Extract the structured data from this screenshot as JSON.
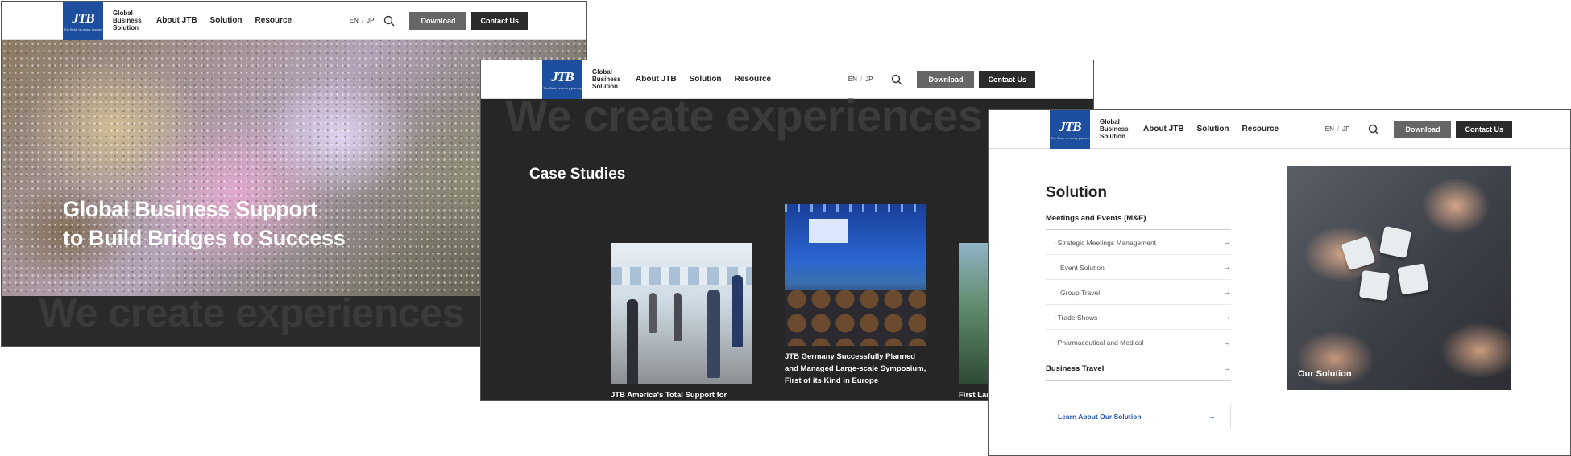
{
  "header": {
    "brand_line1": "Global",
    "brand_line2": "Business",
    "brand_line3": "Solution",
    "logo_mark": "JTB",
    "logo_tagline": "The Best, on every journey",
    "nav": [
      "About JTB",
      "Solution",
      "Resource"
    ],
    "lang_en": "EN",
    "lang_sep": "/",
    "lang_jp": "JP",
    "search_icon": "search-icon",
    "download_label": "Download",
    "contact_label": "Contact Us"
  },
  "hero": {
    "title_line1": "Global Business Support",
    "title_line2": "to Build Bridges to Success",
    "ghost_text": "We create experiences"
  },
  "case_studies": {
    "ghost_text": "We create experiences",
    "title": "Case Studies",
    "cards": [
      {
        "caption": "JTB America's Total Support for Bushiroad's Booth at the Largest Anime Expo in North America"
      },
      {
        "caption": "JTB Germany Successfully Planned and Managed Large-scale Symposium, First of its Kind in Europe"
      },
      {
        "caption": "First Lar Incentiv Between Busines"
      }
    ]
  },
  "solution": {
    "title": "Solution",
    "category": "Meetings and Events (M&E)",
    "items": [
      "Strategic Meetings Management",
      "Event Solution",
      "Group Travel",
      "Trade Shows",
      "Pharmaceutical and Medical"
    ],
    "business_travel": "Business Travel",
    "learn_more": "Learn About Our Solution",
    "image_label": "Our Solution",
    "arrow": "→"
  },
  "colors": {
    "logo_blue": "#1d4f9e",
    "download_gray": "#666666",
    "contact_dark": "#2b2b2b",
    "link_blue": "#1f55b3",
    "dark_section": "#262626"
  }
}
